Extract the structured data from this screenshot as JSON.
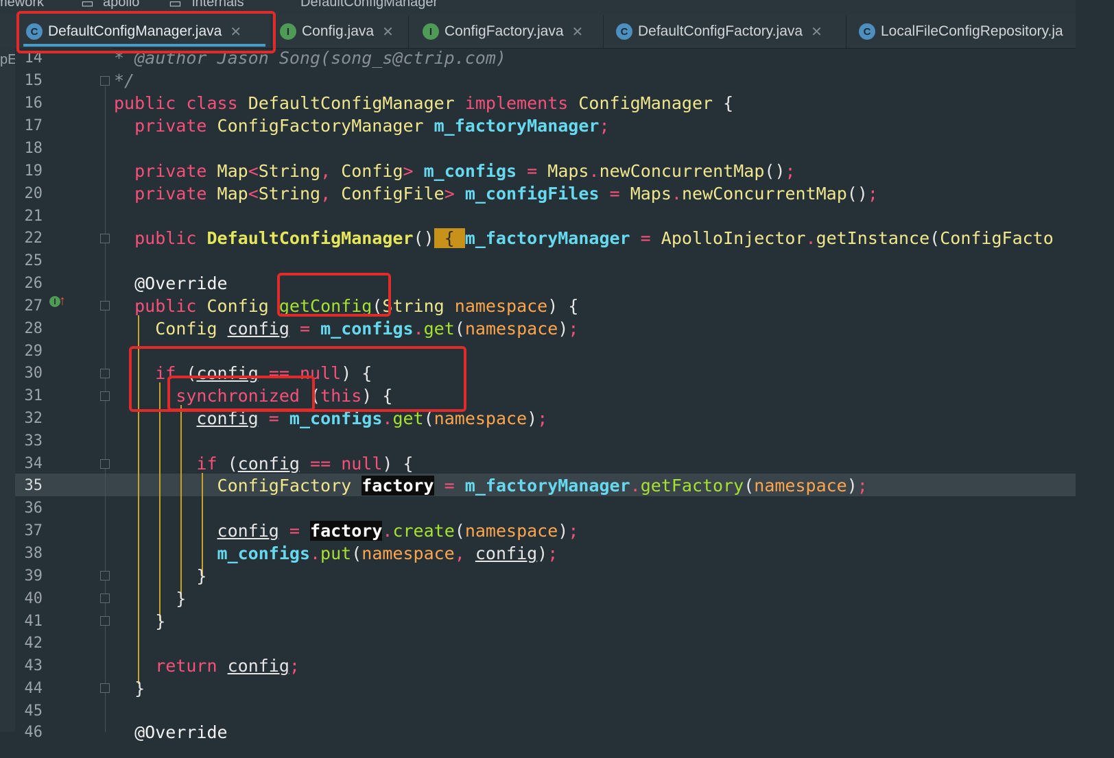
{
  "breadcrumb": [
    "mework",
    "apollo",
    "internals",
    "DefaultConfigManager"
  ],
  "tabs": [
    {
      "label": "DefaultConfigManager.java",
      "icon": "class-icon",
      "active": true
    },
    {
      "label": "Config.java",
      "icon": "interface-icon",
      "active": false
    },
    {
      "label": "ConfigFactory.java",
      "icon": "interface-icon",
      "active": false
    },
    {
      "label": "DefaultConfigFactory.java",
      "icon": "class-icon",
      "active": false
    },
    {
      "label": "LocalFileConfigRepository.ja",
      "icon": "class-icon",
      "active": false
    }
  ],
  "left_strip_label": "pE",
  "current_line": 35,
  "line_numbers": [
    "14",
    "15",
    "16",
    "17",
    "18",
    "19",
    "20",
    "21",
    "22",
    "25",
    "26",
    "27",
    "28",
    "29",
    "30",
    "31",
    "32",
    "33",
    "34",
    "35",
    "36",
    "37",
    "38",
    "39",
    "40",
    "41",
    "42",
    "43",
    "44",
    "45",
    "46"
  ],
  "code": {
    "l14": "* @author Jason Song(song_s@ctrip.com)",
    "l15": "*/",
    "public": "public",
    "class": "class",
    "implements": "implements",
    "private": "private",
    "if": "if",
    "null": "null",
    "synchronized": "synchronized",
    "this": "this",
    "return": "return",
    "cls_name": "DefaultConfigManager",
    "iface": "ConfigManager",
    "cfm_type": "ConfigFactoryManager",
    "f_factoryManager": "m_factoryManager",
    "map": "Map",
    "string": "String",
    "config_type": "Config",
    "configfile_type": "ConfigFile",
    "f_configs": "m_configs",
    "f_configFiles": "m_configFiles",
    "maps": "Maps",
    "newMap": "newConcurrentMap",
    "injector": "ApolloInjector",
    "getInstance": "getInstance",
    "cf_trunc": "ConfigFacto",
    "override": "@Override",
    "getConfig": "getConfig",
    "namespace": "namespace",
    "config_var": "config",
    "get": "get",
    "cf_type": "ConfigFactory",
    "factory": "factory",
    "getFactory": "getFactory",
    "create": "create",
    "put": "put"
  },
  "colors": {
    "background": "#263037",
    "keyword": "#f9507a",
    "type": "#f0e68c",
    "field": "#66d9ef",
    "parameter": "#ffa64d",
    "method": "#a6e22e",
    "annotation_box": "#e02b2b",
    "tab_underline": "#4a9cc7"
  }
}
